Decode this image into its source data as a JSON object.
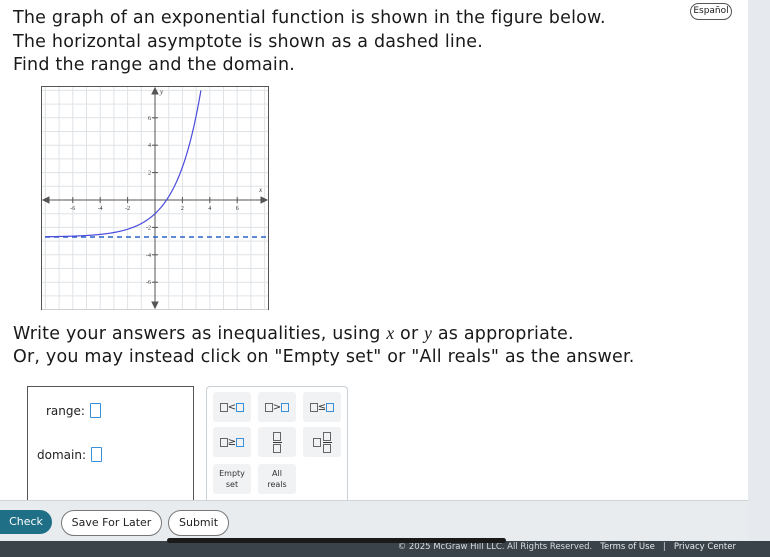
{
  "header": {
    "language_button": "Español"
  },
  "question": {
    "line1": "The graph of an exponential function is shown in the figure below.",
    "line2": "The horizontal asymptote is shown as a dashed line.",
    "line3": "Find the range and the domain.",
    "line4_pre": "Write your answers as inequalities, using ",
    "var_x": "x",
    "line4_or": " or ",
    "var_y": "y",
    "line4_post": " as appropriate.",
    "line5": "Or, you may instead click on \"Empty set\" or \"All reals\" as the answer."
  },
  "graph": {
    "axis_x_label": "x",
    "axis_y_label": "y",
    "x_ticks": [
      "-6",
      "-4",
      "-2",
      "2",
      "4",
      "6"
    ],
    "y_ticks": [
      "6",
      "4",
      "2",
      "-2",
      "-4",
      "-6"
    ],
    "xlim": [
      -8,
      8
    ],
    "ylim": [
      -8,
      8
    ],
    "asymptote_y": -2.7,
    "curve_color": "#4b4bdc",
    "asymptote_color": "#2a63c9"
  },
  "answers": {
    "range_label": "range:",
    "domain_label": "domain:"
  },
  "palette": {
    "empty_set": [
      "Empty",
      "set"
    ],
    "all_reals": [
      "All",
      "reals"
    ]
  },
  "buttons": {
    "check": "Check",
    "save": "Save For Later",
    "submit": "Submit"
  },
  "footer": {
    "copyright": "© 2025 McGraw Hill LLC. All Rights Reserved.",
    "terms": "Terms of Use",
    "separator": "|",
    "privacy": "Privacy Center"
  }
}
